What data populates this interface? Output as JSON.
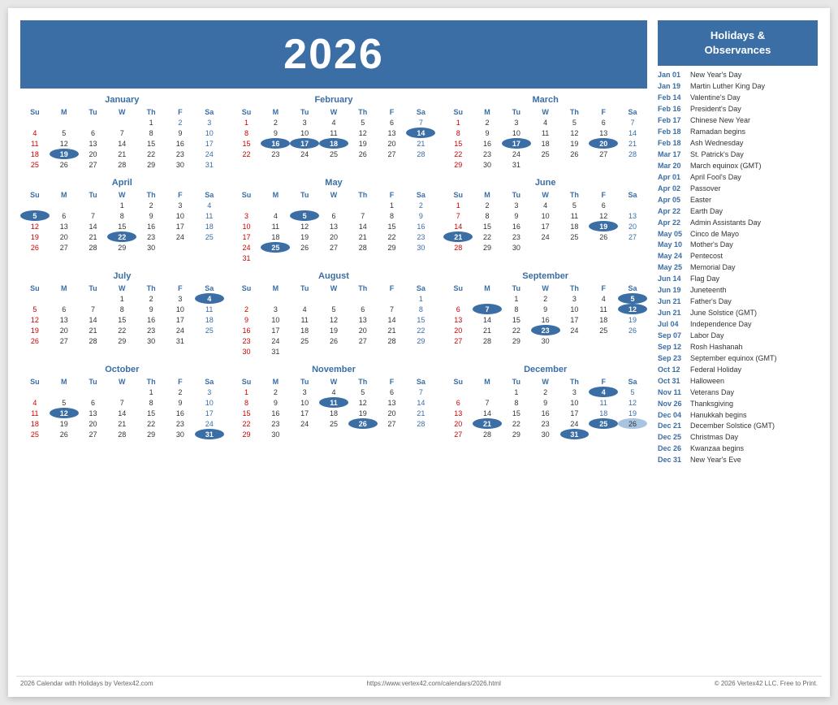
{
  "year": "2026",
  "sidebar": {
    "header": "Holidays &\nObservances",
    "holidays": [
      {
        "date": "Jan 01",
        "name": "New Year's Day"
      },
      {
        "date": "Jan 19",
        "name": "Martin Luther King Day"
      },
      {
        "date": "Feb 14",
        "name": "Valentine's Day"
      },
      {
        "date": "Feb 16",
        "name": "President's Day"
      },
      {
        "date": "Feb 17",
        "name": "Chinese New Year"
      },
      {
        "date": "Feb 18",
        "name": "Ramadan begins"
      },
      {
        "date": "Feb 18",
        "name": "Ash Wednesday"
      },
      {
        "date": "Mar 17",
        "name": "St. Patrick's Day"
      },
      {
        "date": "Mar 20",
        "name": "March equinox (GMT)"
      },
      {
        "date": "Apr 01",
        "name": "April Fool's Day"
      },
      {
        "date": "Apr 02",
        "name": "Passover"
      },
      {
        "date": "Apr 05",
        "name": "Easter"
      },
      {
        "date": "Apr 22",
        "name": "Earth Day"
      },
      {
        "date": "Apr 22",
        "name": "Admin Assistants Day"
      },
      {
        "date": "May 05",
        "name": "Cinco de Mayo"
      },
      {
        "date": "May 10",
        "name": "Mother's Day"
      },
      {
        "date": "May 24",
        "name": "Pentecost"
      },
      {
        "date": "May 25",
        "name": "Memorial Day"
      },
      {
        "date": "Jun 14",
        "name": "Flag Day"
      },
      {
        "date": "Jun 19",
        "name": "Juneteenth"
      },
      {
        "date": "Jun 21",
        "name": "Father's Day"
      },
      {
        "date": "Jun 21",
        "name": "June Solstice (GMT)"
      },
      {
        "date": "Jul 04",
        "name": "Independence Day"
      },
      {
        "date": "Sep 07",
        "name": "Labor Day"
      },
      {
        "date": "Sep 12",
        "name": "Rosh Hashanah"
      },
      {
        "date": "Sep 23",
        "name": "September equinox (GMT)"
      },
      {
        "date": "Oct 12",
        "name": "Federal Holiday"
      },
      {
        "date": "Oct 31",
        "name": "Halloween"
      },
      {
        "date": "Nov 11",
        "name": "Veterans Day"
      },
      {
        "date": "Nov 26",
        "name": "Thanksgiving"
      },
      {
        "date": "Dec 04",
        "name": "Hanukkah begins"
      },
      {
        "date": "Dec 21",
        "name": "December Solstice (GMT)"
      },
      {
        "date": "Dec 25",
        "name": "Christmas Day"
      },
      {
        "date": "Dec 26",
        "name": "Kwanzaa begins"
      },
      {
        "date": "Dec 31",
        "name": "New Year's Eve"
      }
    ]
  },
  "footer": {
    "left": "2026 Calendar with Holidays by Vertex42.com",
    "center": "https://www.vertex42.com/calendars/2026.html",
    "right": "© 2026 Vertex42 LLC. Free to Print."
  }
}
